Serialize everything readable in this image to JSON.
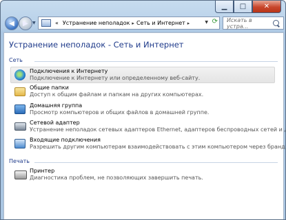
{
  "window": {
    "caption_buttons": {
      "minimize": "▁",
      "maximize": "□",
      "close": "✕"
    }
  },
  "navigation": {
    "path_prefix": "«",
    "breadcrumbs": [
      "Устранение неполадок",
      "Сеть и Интернет"
    ],
    "breadcrumb_separator": "▸",
    "search_placeholder": "Искать в устра..."
  },
  "page": {
    "title": "Устранение неполадок - Сеть и Интернет"
  },
  "groups": [
    {
      "header": "Сеть",
      "items": [
        {
          "name": "Подключения к Интернету",
          "description": "Подключение к Интернету или определенному веб-сайту.",
          "icon": "globe-network-icon",
          "selected": true
        },
        {
          "name": "Общие папки",
          "description": "Доступ к общим файлам и папкам на других компьютерах.",
          "icon": "shared-folder-icon",
          "selected": false
        },
        {
          "name": "Домашняя группа",
          "description": "Просмотр компьютеров и общих файлов в домашней группе.",
          "icon": "homegroup-icon",
          "selected": false
        },
        {
          "name": "Сетевой адаптер",
          "description": "Устранение неполадок сетевых адаптеров Ethernet, адаптеров беспроводных сетей и других...",
          "icon": "network-adapter-icon",
          "selected": false
        },
        {
          "name": "Входящие подключения",
          "description": "Разрешить другим компьютерам взаимодействовать с этим компьютером через брандм...",
          "icon": "incoming-connections-icon",
          "selected": false
        }
      ]
    },
    {
      "header": "Печать",
      "items": [
        {
          "name": "Принтер",
          "description": "Диагностика проблем, не позволяющих завершить печать.",
          "icon": "printer-icon",
          "selected": false
        }
      ]
    }
  ],
  "colors": {
    "title": "#1e3a8a",
    "window_frame": "#b6cfe8",
    "close_button": "#c8462c"
  }
}
